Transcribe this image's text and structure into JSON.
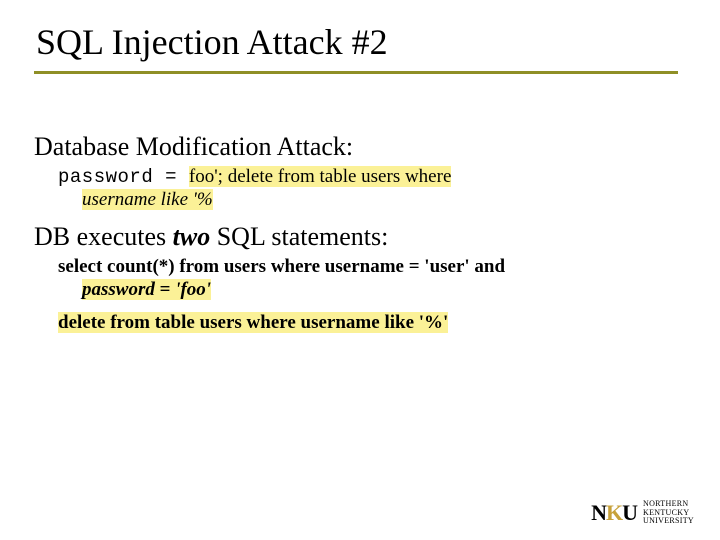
{
  "title": "SQL Injection Attack #2",
  "section1": {
    "heading": "Database Modification Attack:",
    "line1": {
      "prefix": "password = ",
      "hl": "foo'; delete from table users where"
    },
    "line2_hl": "username like '%"
  },
  "section2": {
    "heading_pre": "DB executes ",
    "heading_em": "two",
    "heading_post": " SQL statements:",
    "stmt1": {
      "a": "select count(*) from users where username = 'user' and",
      "b_pre": "password",
      "b_eq": " = ",
      "b_val": "'foo'"
    },
    "stmt2": "delete from table users where username like '%'"
  },
  "logo": {
    "mark_left": "N",
    "mark_mid": "K",
    "mark_right": "U",
    "text_l1": "NORTHERN",
    "text_l2": "KENTUCKY",
    "text_l3": "UNIVERSITY"
  }
}
